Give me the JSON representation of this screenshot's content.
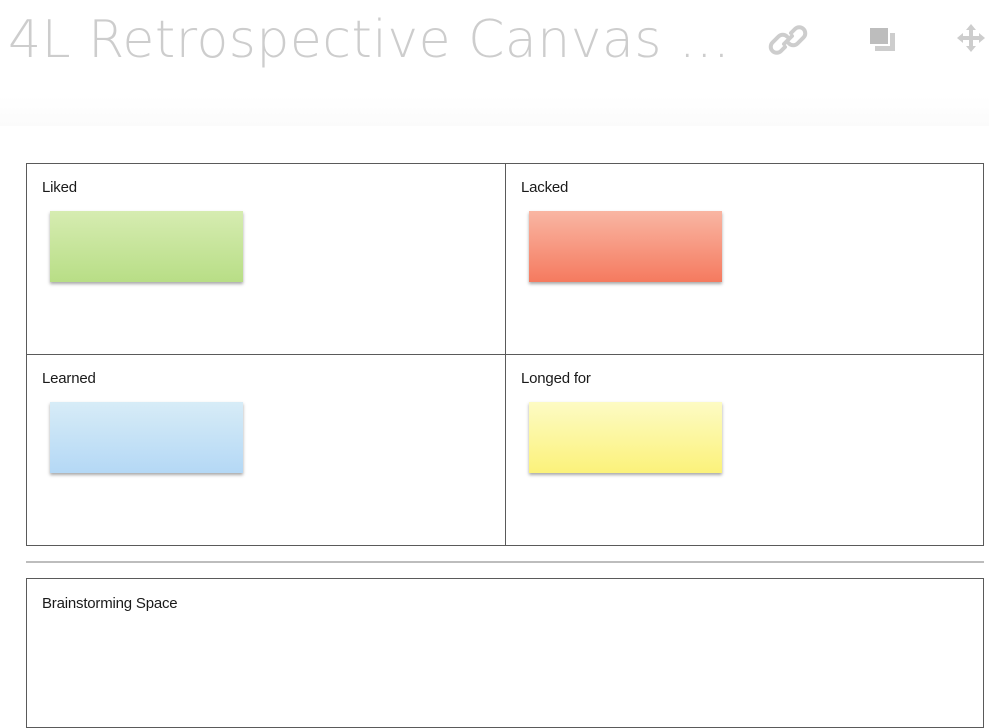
{
  "header": {
    "title": "4L Retrospective Canvas ...",
    "icons": [
      "link-icon",
      "copy-icon",
      "move-icon"
    ]
  },
  "board": {
    "quadrants": [
      {
        "label": "Liked",
        "sticky_color": "#c4e497"
      },
      {
        "label": "Lacked",
        "sticky_color": "#f7937a"
      },
      {
        "label": "Learned",
        "sticky_color": "#c3e0f6"
      },
      {
        "label": "Longed for",
        "sticky_color": "#fcf59c"
      }
    ]
  },
  "brainstorm": {
    "label": "Brainstorming Space"
  },
  "colors": {
    "title": "#cdcdcd",
    "border": "#5a5a5a",
    "divider": "#bdbdbd"
  }
}
